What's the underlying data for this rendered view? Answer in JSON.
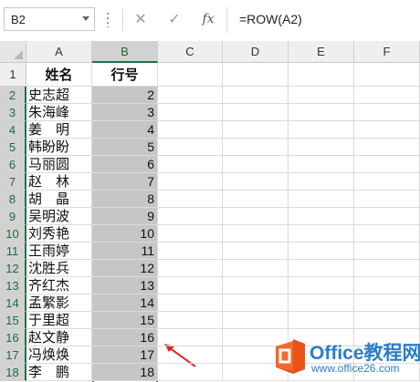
{
  "formula_bar": {
    "name_box": "B2",
    "formula": "=ROW(A2)",
    "cancel_icon": "✕",
    "enter_icon": "✓",
    "fx_label": "fx"
  },
  "grid": {
    "columns": [
      "A",
      "B",
      "C",
      "D",
      "E",
      "F"
    ],
    "selected_column": "B",
    "header_row": {
      "row_number": "1",
      "A": "姓名",
      "B": "行号"
    },
    "rows": [
      {
        "n": "2",
        "name": "史志超",
        "value": "2"
      },
      {
        "n": "3",
        "name": "朱海峰",
        "value": "3"
      },
      {
        "n": "4",
        "name": "姜　明",
        "value": "4"
      },
      {
        "n": "5",
        "name": "韩盼盼",
        "value": "5"
      },
      {
        "n": "6",
        "name": "马丽圆",
        "value": "6"
      },
      {
        "n": "7",
        "name": "赵　林",
        "value": "7"
      },
      {
        "n": "8",
        "name": "胡　晶",
        "value": "8"
      },
      {
        "n": "9",
        "name": "吴明波",
        "value": "9"
      },
      {
        "n": "10",
        "name": "刘秀艳",
        "value": "10"
      },
      {
        "n": "11",
        "name": "王雨婷",
        "value": "11"
      },
      {
        "n": "12",
        "name": "沈胜兵",
        "value": "12"
      },
      {
        "n": "13",
        "name": "齐红杰",
        "value": "13"
      },
      {
        "n": "14",
        "name": "孟繁影",
        "value": "14"
      },
      {
        "n": "15",
        "name": "于里超",
        "value": "15"
      },
      {
        "n": "16",
        "name": "赵文静",
        "value": "16"
      },
      {
        "n": "17",
        "name": "冯焕焕",
        "value": "17"
      },
      {
        "n": "18",
        "name": "李　鹏",
        "value": "18"
      }
    ]
  },
  "watermark": {
    "title": "Office教程网",
    "url": "www.office26.com"
  },
  "colors": {
    "selection": "#217346",
    "selected_fill": "#c6c6c6",
    "arrow": "#e02020",
    "watermark": "#2a7ec7",
    "logo": "#e8531a"
  }
}
